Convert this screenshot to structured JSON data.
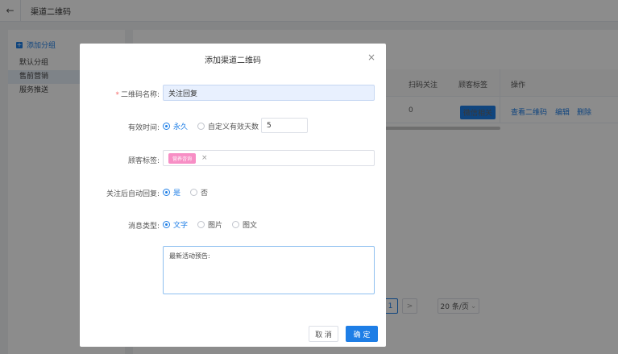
{
  "header": {
    "back_icon": "arrow-left-icon",
    "title": "渠道二维码"
  },
  "sidebar": {
    "add_group_label": "添加分组",
    "groups": [
      {
        "label": "默认分组"
      },
      {
        "label": "售前营销"
      },
      {
        "label": "服务推送"
      }
    ]
  },
  "table": {
    "headers": {
      "scan": "扫码关注",
      "tags": "顾客标签",
      "actions": "操作"
    },
    "row": {
      "scan": "0",
      "tag": "微信相关",
      "view_qr": "查看二维码",
      "edit": "编辑",
      "delete": "删除"
    }
  },
  "pagination": {
    "prev": "<",
    "current": "1",
    "next": ">",
    "page_size": "20 条/页"
  },
  "dialog": {
    "title": "添加渠道二维码",
    "close": "×",
    "name_label": "二维码名称:",
    "name_required": "*",
    "name_value": "关注回复",
    "validity_label": "有效时间:",
    "validity_permanent": "永久",
    "validity_custom": "自定义有效天数",
    "validity_days": "5",
    "tags_label": "顾客标签:",
    "tag_chip": "营养咨询",
    "tag_remove": "×",
    "auto_reply_label": "关注后自动回复:",
    "auto_reply_yes": "是",
    "auto_reply_no": "否",
    "msg_type_label": "消息类型:",
    "msg_type_text": "文字",
    "msg_type_image": "图片",
    "msg_type_news": "图文",
    "message_content": "最新活动预告:",
    "cancel": "取 消",
    "confirm": "确 定"
  },
  "colors": {
    "primary": "#1e7ee6",
    "tag_pink": "#f78ec5",
    "required": "#f56c6c"
  }
}
